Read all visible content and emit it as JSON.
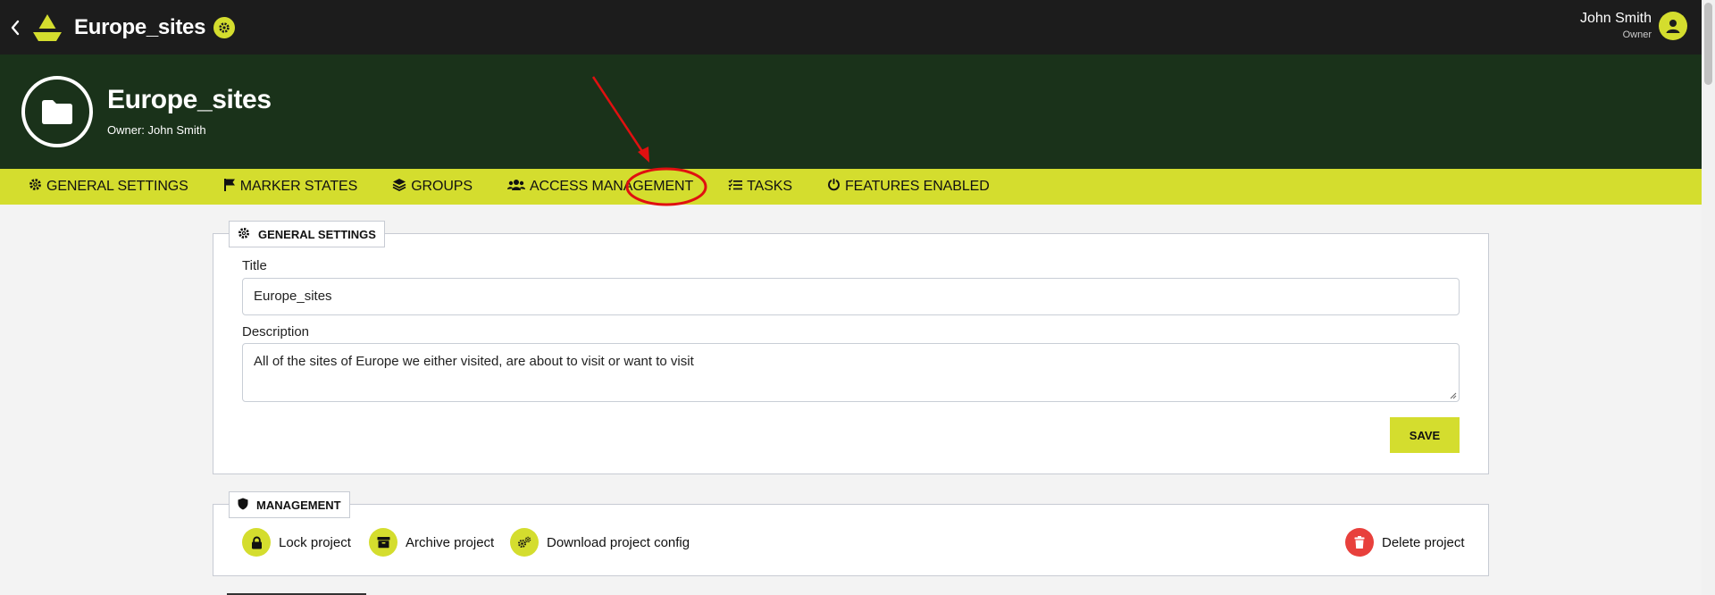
{
  "header": {
    "app_title": "Europe_sites",
    "user_name": "John Smith",
    "user_role": "Owner",
    "icons": [
      "back-icon",
      "app-logo",
      "settings-icon",
      "user-avatar-icon"
    ]
  },
  "banner": {
    "title": "Europe_sites",
    "owner": "Owner: John Smith",
    "icon": "folder-icon"
  },
  "tabs": [
    {
      "label": "GENERAL SETTINGS",
      "icon": "gear-icon"
    },
    {
      "label": "MARKER STATES",
      "icon": "flag-icon"
    },
    {
      "label": "GROUPS",
      "icon": "layers-icon"
    },
    {
      "label": "ACCESS MANAGEMENT",
      "icon": "users-icon"
    },
    {
      "label": "TASKS",
      "icon": "task-list-icon"
    },
    {
      "label": "FEATURES ENABLED",
      "icon": "power-icon"
    }
  ],
  "general_settings": {
    "heading": "GENERAL SETTINGS",
    "title_label": "Title",
    "title_value": "Europe_sites",
    "description_label": "Description",
    "description_value": "All of the sites of Europe we either visited, are about to visit or want to visit",
    "save_label": "SAVE"
  },
  "management": {
    "heading": "MANAGEMENT",
    "actions": [
      {
        "label": "Lock project",
        "icon": "lock-icon"
      },
      {
        "label": "Archive project",
        "icon": "archive-icon"
      },
      {
        "label": "Download project config",
        "icon": "gears-icon"
      },
      {
        "label": "Delete project",
        "icon": "trash-icon"
      }
    ]
  },
  "colors": {
    "accent": "#d4dd2e",
    "topbar": "#1c1c1c",
    "banner": "#1a321a",
    "danger": "#e8403c",
    "annotation": "#e01010"
  }
}
